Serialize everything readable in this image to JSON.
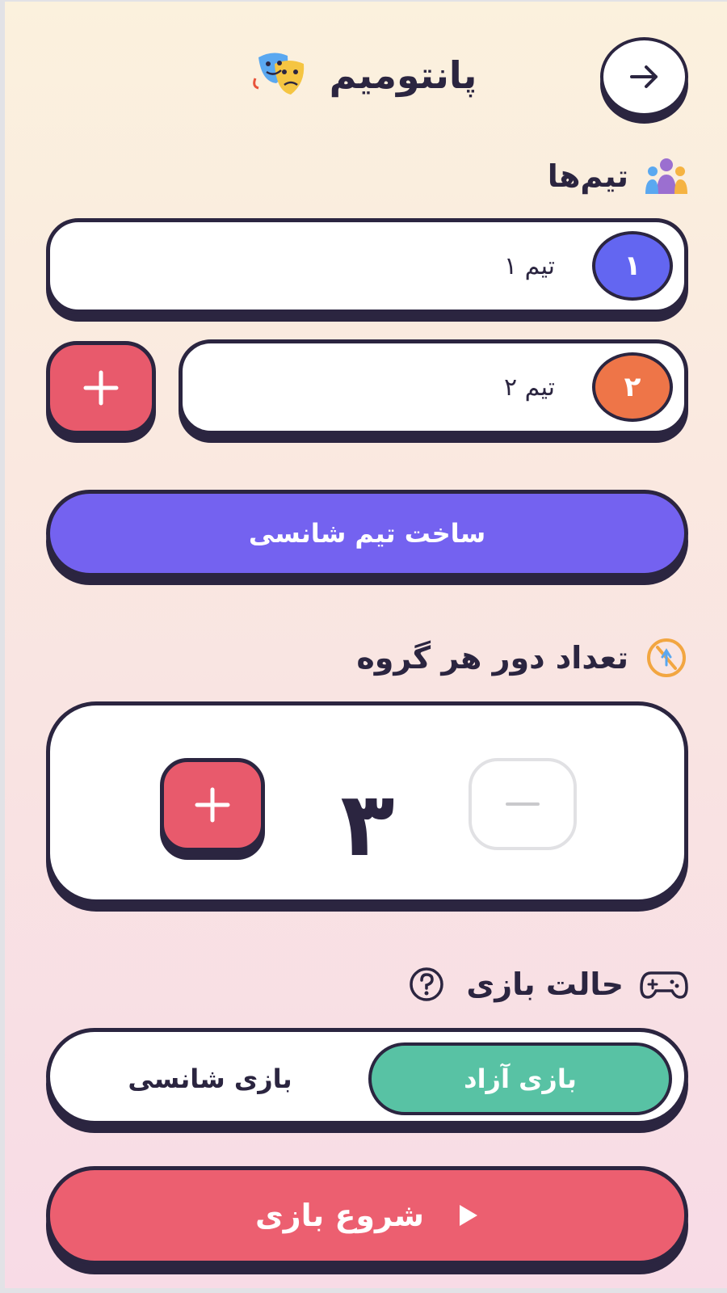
{
  "header": {
    "title": "پانتومیم",
    "back_icon": "arrow-right-icon",
    "logo_icon": "theater-masks-icon"
  },
  "teams_section": {
    "heading": "تیم‌ها",
    "icon": "people-group-icon",
    "teams": [
      {
        "number": "۱",
        "name": "تیم ۱",
        "color": "#6366f1"
      },
      {
        "number": "۲",
        "name": "تیم ۲",
        "color": "#ee7548"
      }
    ],
    "add_icon": "plus-icon",
    "random_team_label": "ساخت تیم شانسی"
  },
  "rounds_section": {
    "heading": "تعداد دور هر گروه",
    "icon": "timer-dial-icon",
    "value": "۳",
    "increment_icon": "plus-icon",
    "decrement_icon": "minus-icon"
  },
  "mode_section": {
    "heading": "حالت بازی",
    "icon": "gamepad-icon",
    "help_icon": "question-circle-icon",
    "options": [
      {
        "label": "بازی آزاد",
        "selected": true
      },
      {
        "label": "بازی شانسی",
        "selected": false
      }
    ]
  },
  "start_button": {
    "label": "شروع بازی",
    "icon": "play-icon"
  },
  "colors": {
    "primary": "#7462f0",
    "danger": "#e85a6c",
    "success": "#58c2a4",
    "outline": "#2b2540"
  }
}
